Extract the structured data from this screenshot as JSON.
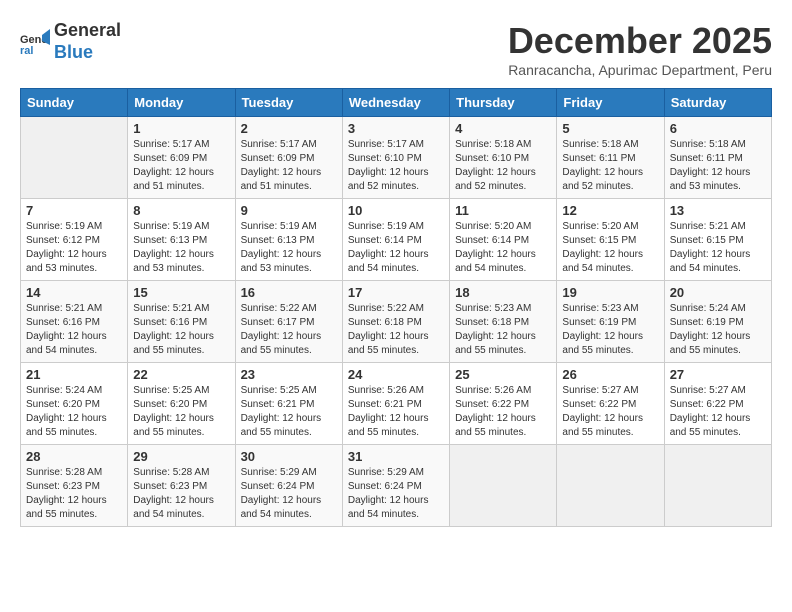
{
  "logo": {
    "line1": "General",
    "line2": "Blue"
  },
  "title": "December 2025",
  "location": "Ranracancha, Apurimac Department, Peru",
  "days_of_week": [
    "Sunday",
    "Monday",
    "Tuesday",
    "Wednesday",
    "Thursday",
    "Friday",
    "Saturday"
  ],
  "weeks": [
    [
      {
        "day": "",
        "info": ""
      },
      {
        "day": "1",
        "info": "Sunrise: 5:17 AM\nSunset: 6:09 PM\nDaylight: 12 hours\nand 51 minutes."
      },
      {
        "day": "2",
        "info": "Sunrise: 5:17 AM\nSunset: 6:09 PM\nDaylight: 12 hours\nand 51 minutes."
      },
      {
        "day": "3",
        "info": "Sunrise: 5:17 AM\nSunset: 6:10 PM\nDaylight: 12 hours\nand 52 minutes."
      },
      {
        "day": "4",
        "info": "Sunrise: 5:18 AM\nSunset: 6:10 PM\nDaylight: 12 hours\nand 52 minutes."
      },
      {
        "day": "5",
        "info": "Sunrise: 5:18 AM\nSunset: 6:11 PM\nDaylight: 12 hours\nand 52 minutes."
      },
      {
        "day": "6",
        "info": "Sunrise: 5:18 AM\nSunset: 6:11 PM\nDaylight: 12 hours\nand 53 minutes."
      }
    ],
    [
      {
        "day": "7",
        "info": "Sunrise: 5:19 AM\nSunset: 6:12 PM\nDaylight: 12 hours\nand 53 minutes."
      },
      {
        "day": "8",
        "info": "Sunrise: 5:19 AM\nSunset: 6:13 PM\nDaylight: 12 hours\nand 53 minutes."
      },
      {
        "day": "9",
        "info": "Sunrise: 5:19 AM\nSunset: 6:13 PM\nDaylight: 12 hours\nand 53 minutes."
      },
      {
        "day": "10",
        "info": "Sunrise: 5:19 AM\nSunset: 6:14 PM\nDaylight: 12 hours\nand 54 minutes."
      },
      {
        "day": "11",
        "info": "Sunrise: 5:20 AM\nSunset: 6:14 PM\nDaylight: 12 hours\nand 54 minutes."
      },
      {
        "day": "12",
        "info": "Sunrise: 5:20 AM\nSunset: 6:15 PM\nDaylight: 12 hours\nand 54 minutes."
      },
      {
        "day": "13",
        "info": "Sunrise: 5:21 AM\nSunset: 6:15 PM\nDaylight: 12 hours\nand 54 minutes."
      }
    ],
    [
      {
        "day": "14",
        "info": "Sunrise: 5:21 AM\nSunset: 6:16 PM\nDaylight: 12 hours\nand 54 minutes."
      },
      {
        "day": "15",
        "info": "Sunrise: 5:21 AM\nSunset: 6:16 PM\nDaylight: 12 hours\nand 55 minutes."
      },
      {
        "day": "16",
        "info": "Sunrise: 5:22 AM\nSunset: 6:17 PM\nDaylight: 12 hours\nand 55 minutes."
      },
      {
        "day": "17",
        "info": "Sunrise: 5:22 AM\nSunset: 6:18 PM\nDaylight: 12 hours\nand 55 minutes."
      },
      {
        "day": "18",
        "info": "Sunrise: 5:23 AM\nSunset: 6:18 PM\nDaylight: 12 hours\nand 55 minutes."
      },
      {
        "day": "19",
        "info": "Sunrise: 5:23 AM\nSunset: 6:19 PM\nDaylight: 12 hours\nand 55 minutes."
      },
      {
        "day": "20",
        "info": "Sunrise: 5:24 AM\nSunset: 6:19 PM\nDaylight: 12 hours\nand 55 minutes."
      }
    ],
    [
      {
        "day": "21",
        "info": "Sunrise: 5:24 AM\nSunset: 6:20 PM\nDaylight: 12 hours\nand 55 minutes."
      },
      {
        "day": "22",
        "info": "Sunrise: 5:25 AM\nSunset: 6:20 PM\nDaylight: 12 hours\nand 55 minutes."
      },
      {
        "day": "23",
        "info": "Sunrise: 5:25 AM\nSunset: 6:21 PM\nDaylight: 12 hours\nand 55 minutes."
      },
      {
        "day": "24",
        "info": "Sunrise: 5:26 AM\nSunset: 6:21 PM\nDaylight: 12 hours\nand 55 minutes."
      },
      {
        "day": "25",
        "info": "Sunrise: 5:26 AM\nSunset: 6:22 PM\nDaylight: 12 hours\nand 55 minutes."
      },
      {
        "day": "26",
        "info": "Sunrise: 5:27 AM\nSunset: 6:22 PM\nDaylight: 12 hours\nand 55 minutes."
      },
      {
        "day": "27",
        "info": "Sunrise: 5:27 AM\nSunset: 6:22 PM\nDaylight: 12 hours\nand 55 minutes."
      }
    ],
    [
      {
        "day": "28",
        "info": "Sunrise: 5:28 AM\nSunset: 6:23 PM\nDaylight: 12 hours\nand 55 minutes."
      },
      {
        "day": "29",
        "info": "Sunrise: 5:28 AM\nSunset: 6:23 PM\nDaylight: 12 hours\nand 54 minutes."
      },
      {
        "day": "30",
        "info": "Sunrise: 5:29 AM\nSunset: 6:24 PM\nDaylight: 12 hours\nand 54 minutes."
      },
      {
        "day": "31",
        "info": "Sunrise: 5:29 AM\nSunset: 6:24 PM\nDaylight: 12 hours\nand 54 minutes."
      },
      {
        "day": "",
        "info": ""
      },
      {
        "day": "",
        "info": ""
      },
      {
        "day": "",
        "info": ""
      }
    ]
  ]
}
